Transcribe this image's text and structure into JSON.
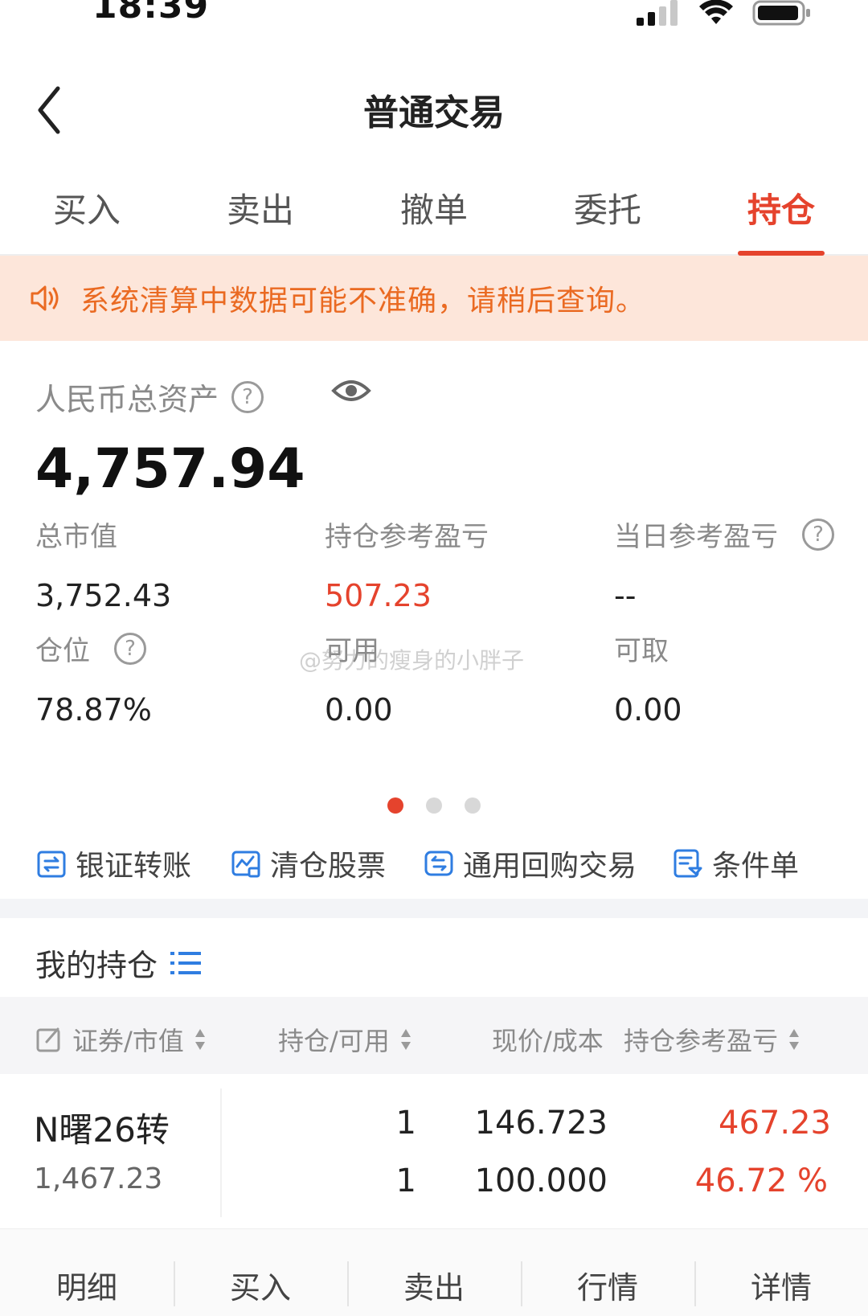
{
  "status_bar": {
    "time": "18:39"
  },
  "nav": {
    "title": "普通交易"
  },
  "tabs": [
    {
      "label": "买入",
      "active": false
    },
    {
      "label": "卖出",
      "active": false
    },
    {
      "label": "撤单",
      "active": false
    },
    {
      "label": "委托",
      "active": false
    },
    {
      "label": "持仓",
      "active": true
    }
  ],
  "notice": {
    "text": "系统清算中数据可能不准确，请稍后查询。",
    "icon": "speaker-icon"
  },
  "assets": {
    "total_label": "人民币总资产",
    "total_value": "4,757.94",
    "market_value_label": "总市值",
    "market_value": "3,752.43",
    "position_pnl_label": "持仓参考盈亏",
    "position_pnl": "507.23",
    "daily_pnl_label": "当日参考盈亏",
    "daily_pnl": "--",
    "position_ratio_label": "仓位",
    "position_ratio": "78.87%",
    "available_label": "可用",
    "available": "0.00",
    "withdrawable_label": "可取",
    "withdrawable": "0.00",
    "page_count": 3,
    "page_active": 1
  },
  "watermark": "@努力的瘦身的小胖子",
  "quick_actions": [
    {
      "label": "银证转账",
      "icon": "bank-transfer-icon"
    },
    {
      "label": "清仓股票",
      "icon": "chart-clear-icon"
    },
    {
      "label": "通用回购交易",
      "icon": "repo-icon"
    },
    {
      "label": "条件单",
      "icon": "condition-order-icon"
    }
  ],
  "holdings": {
    "title": "我的持仓",
    "columns": {
      "security": "证券/市值",
      "position": "持仓/可用",
      "price": "现价/成本",
      "pnl": "持仓参考盈亏"
    },
    "rows": [
      {
        "name": "N曙26转",
        "market_value": "1,467.23",
        "position": "1",
        "available": "1",
        "current_price": "146.723",
        "cost": "100.000",
        "pnl": "467.23",
        "pnl_pct": "46.72 %"
      }
    ]
  },
  "bottom_bar": [
    "明细",
    "买入",
    "卖出",
    "行情",
    "详情"
  ],
  "colors": {
    "accent": "#e5432d",
    "notice_bg": "#fde6da",
    "notice_text": "#ea6a22"
  }
}
